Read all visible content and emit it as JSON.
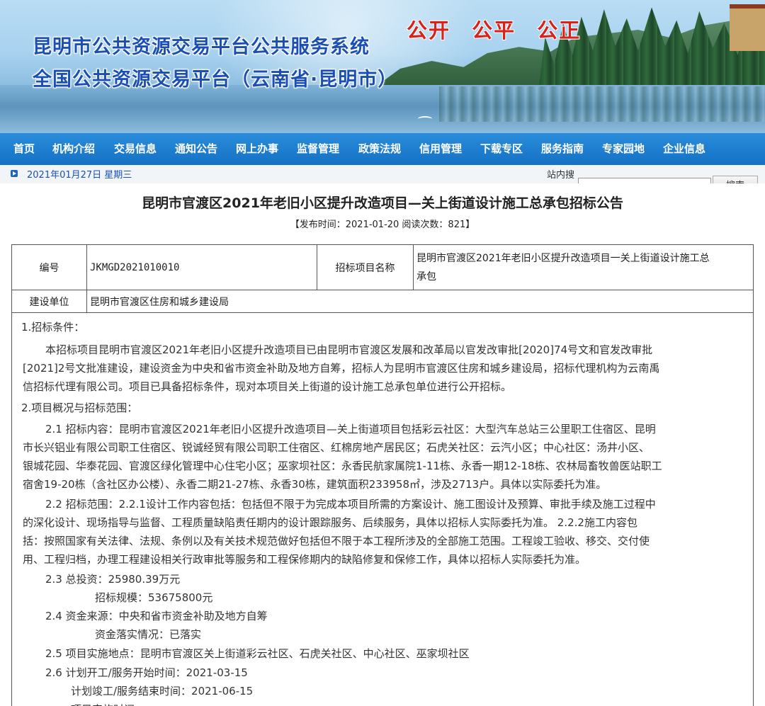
{
  "banner": {
    "title_line1": "昆明市公共资源交易平台公共服务系统",
    "title_line2": "全国公共资源交易平台（云南省·昆明市）",
    "slogan": "公开 公平 公正"
  },
  "nav": {
    "items": [
      "首页",
      "机构介绍",
      "交易信息",
      "通知公告",
      "网上办事",
      "监督管理",
      "政策法规",
      "信用管理",
      "下载专区",
      "服务指南",
      "专家园地",
      "企业信息"
    ]
  },
  "datebar": {
    "date": "2021年01月27日  星期三",
    "search_label": "站内搜",
    "search_placeholder": "",
    "search_button": "搜索"
  },
  "article": {
    "title": "昆明市官渡区2021年老旧小区提升改造项目—关上街道设计施工总承包招标公告",
    "meta": "【发布时间：2021-01-20  阅读次数：821】",
    "table": {
      "row1": {
        "label_no": "编号",
        "value_no": "JKMGD2021010010",
        "label_name": "招标项目名称",
        "value_name_line1": "昆明市官渡区2021年老旧小区提升改造项目一关上街道设计施工总",
        "value_name_line2": "承包"
      },
      "row2": {
        "label_unit": "建设单位",
        "value_unit": "昆明市官渡区住房和城乡建设局"
      }
    },
    "lines": [
      "1.招标条件：",
      "本招标项目昆明市官渡区2021年老旧小区提升改造项目已由昆明市官渡区发展和改革局以官发改审批[2020]74号文和官发改审批",
      "[2021]2号文批准建设，建设资金为中央和省市资金补助及地方自筹，招标人为昆明市官渡区住房和城乡建设局，招标代理机构为云南禹",
      "信招标代理有限公司。项目已具备招标条件，现对本项目关上街道的设计施工总承包单位进行公开招标。",
      "2.项目概况与招标范围：",
      "2.1 招标内容：昆明市官渡区2021年老旧小区提升改造项目—关上街道项目包括彩云社区：大型汽车总站三公里职工住宿区、昆明",
      "市长兴铝业有限公司职工住宿区、锐诚经贸有限公司职工住宿区、红棉房地产居民区；石虎关社区：云汽小区；中心社区：汤井小区、",
      "银城花园、华泰花园、官渡区绿化管理中心住宅小区；巫家坝社区：永香民航家属院1-11栋、永香一期12-18栋、农林局畜牧兽医站职工",
      "宿舍19-20栋（含社区办公楼）、永香二期21-27栋、永香30栋，建筑面积233958㎡，涉及2713户。具体以实际委托为准。",
      "2.2 招标范围：2.2.1设计工作内容包括：包括但不限于为完成本项目所需的方案设计、施工图设计及预算、审批手续及施工过程中",
      "的深化设计、现场指导与监督、工程质量缺陷责任期内的设计跟踪服务、后续服务，具体以招标人实际委托为准。 2.2.2施工内容包",
      "括：按照国家有关法律、法规、条例以及有关技术规范做好包括但不限于本工程所涉及的全部施工范围。工程竣工验收、移交、交付使",
      "用、工程归档，办理工程建设相关行政审批等服务和工程保修期内的缺陷修复和保修工作，具体以招标人实际委托为准。",
      "2.3 总投资：25980.39万元",
      "招标规模：53675800元",
      "2.4 资金来源：中央和省市资金补助及地方自筹",
      "资金落实情况：已落实",
      "2.5 项目实施地点：昆明市官渡区关上街道彩云社区、石虎关社区、中心社区、巫家坝社区",
      "2.6 计划开工/服务开始时间：2021-03-15",
      "计划竣工/服务结束时间：2021-06-15",
      "项目实施时间"
    ]
  }
}
